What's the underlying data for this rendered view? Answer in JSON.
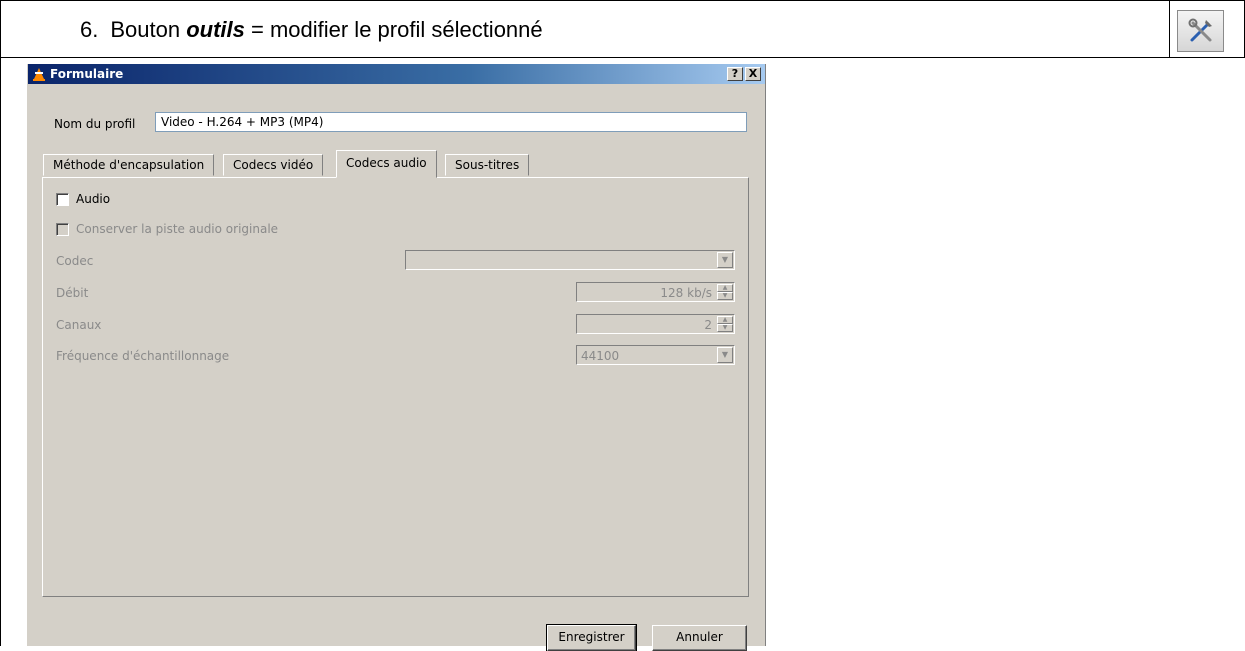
{
  "document": {
    "step_number": "6.",
    "heading_prefix": "Bouton ",
    "heading_emphasis": "outils",
    "heading_suffix": " = modifier le profil sélectionné",
    "tool_button_icon": "tools-icon"
  },
  "dialog": {
    "title": "Formulaire",
    "help_button": "?",
    "close_button": "X",
    "profile_label": "Nom du profil",
    "profile_value": "Video - H.264 + MP3 (MP4)",
    "tabs": [
      {
        "label": "Méthode d'encapsulation",
        "active": false
      },
      {
        "label": "Codecs vidéo",
        "active": false
      },
      {
        "label": "Codecs audio",
        "active": true
      },
      {
        "label": "Sous-titres",
        "active": false
      }
    ],
    "audio_panel": {
      "audio_checkbox_label": "Audio",
      "audio_checked": false,
      "keep_original_label": "Conserver la piste audio originale",
      "keep_original_checked": false,
      "codec_label": "Codec",
      "codec_value": "",
      "bitrate_label": "Débit",
      "bitrate_value": "128 kb/s",
      "channels_label": "Canaux",
      "channels_value": "2",
      "samplerate_label": "Fréquence d'échantillonnage",
      "samplerate_value": "44100"
    },
    "save_button": "Enregistrer",
    "cancel_button": "Annuler"
  }
}
